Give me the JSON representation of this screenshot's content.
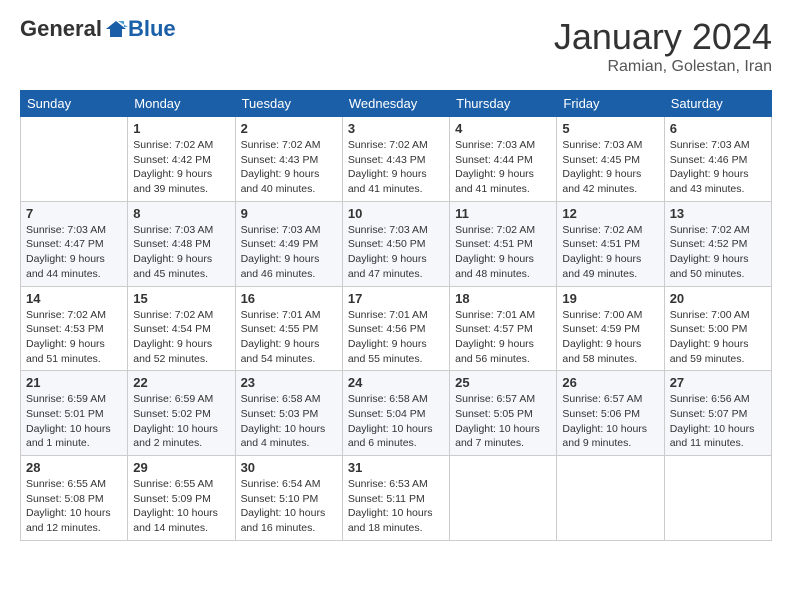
{
  "header": {
    "logo": {
      "general": "General",
      "blue": "Blue"
    },
    "month": "January 2024",
    "location": "Ramian, Golestan, Iran"
  },
  "weekdays": [
    "Sunday",
    "Monday",
    "Tuesday",
    "Wednesday",
    "Thursday",
    "Friday",
    "Saturday"
  ],
  "weeks": [
    [
      {
        "day": "",
        "sunrise": "",
        "sunset": "",
        "daylight": ""
      },
      {
        "day": "1",
        "sunrise": "Sunrise: 7:02 AM",
        "sunset": "Sunset: 4:42 PM",
        "daylight": "Daylight: 9 hours and 39 minutes."
      },
      {
        "day": "2",
        "sunrise": "Sunrise: 7:02 AM",
        "sunset": "Sunset: 4:43 PM",
        "daylight": "Daylight: 9 hours and 40 minutes."
      },
      {
        "day": "3",
        "sunrise": "Sunrise: 7:02 AM",
        "sunset": "Sunset: 4:43 PM",
        "daylight": "Daylight: 9 hours and 41 minutes."
      },
      {
        "day": "4",
        "sunrise": "Sunrise: 7:03 AM",
        "sunset": "Sunset: 4:44 PM",
        "daylight": "Daylight: 9 hours and 41 minutes."
      },
      {
        "day": "5",
        "sunrise": "Sunrise: 7:03 AM",
        "sunset": "Sunset: 4:45 PM",
        "daylight": "Daylight: 9 hours and 42 minutes."
      },
      {
        "day": "6",
        "sunrise": "Sunrise: 7:03 AM",
        "sunset": "Sunset: 4:46 PM",
        "daylight": "Daylight: 9 hours and 43 minutes."
      }
    ],
    [
      {
        "day": "7",
        "sunrise": "Sunrise: 7:03 AM",
        "sunset": "Sunset: 4:47 PM",
        "daylight": "Daylight: 9 hours and 44 minutes."
      },
      {
        "day": "8",
        "sunrise": "Sunrise: 7:03 AM",
        "sunset": "Sunset: 4:48 PM",
        "daylight": "Daylight: 9 hours and 45 minutes."
      },
      {
        "day": "9",
        "sunrise": "Sunrise: 7:03 AM",
        "sunset": "Sunset: 4:49 PM",
        "daylight": "Daylight: 9 hours and 46 minutes."
      },
      {
        "day": "10",
        "sunrise": "Sunrise: 7:03 AM",
        "sunset": "Sunset: 4:50 PM",
        "daylight": "Daylight: 9 hours and 47 minutes."
      },
      {
        "day": "11",
        "sunrise": "Sunrise: 7:02 AM",
        "sunset": "Sunset: 4:51 PM",
        "daylight": "Daylight: 9 hours and 48 minutes."
      },
      {
        "day": "12",
        "sunrise": "Sunrise: 7:02 AM",
        "sunset": "Sunset: 4:51 PM",
        "daylight": "Daylight: 9 hours and 49 minutes."
      },
      {
        "day": "13",
        "sunrise": "Sunrise: 7:02 AM",
        "sunset": "Sunset: 4:52 PM",
        "daylight": "Daylight: 9 hours and 50 minutes."
      }
    ],
    [
      {
        "day": "14",
        "sunrise": "Sunrise: 7:02 AM",
        "sunset": "Sunset: 4:53 PM",
        "daylight": "Daylight: 9 hours and 51 minutes."
      },
      {
        "day": "15",
        "sunrise": "Sunrise: 7:02 AM",
        "sunset": "Sunset: 4:54 PM",
        "daylight": "Daylight: 9 hours and 52 minutes."
      },
      {
        "day": "16",
        "sunrise": "Sunrise: 7:01 AM",
        "sunset": "Sunset: 4:55 PM",
        "daylight": "Daylight: 9 hours and 54 minutes."
      },
      {
        "day": "17",
        "sunrise": "Sunrise: 7:01 AM",
        "sunset": "Sunset: 4:56 PM",
        "daylight": "Daylight: 9 hours and 55 minutes."
      },
      {
        "day": "18",
        "sunrise": "Sunrise: 7:01 AM",
        "sunset": "Sunset: 4:57 PM",
        "daylight": "Daylight: 9 hours and 56 minutes."
      },
      {
        "day": "19",
        "sunrise": "Sunrise: 7:00 AM",
        "sunset": "Sunset: 4:59 PM",
        "daylight": "Daylight: 9 hours and 58 minutes."
      },
      {
        "day": "20",
        "sunrise": "Sunrise: 7:00 AM",
        "sunset": "Sunset: 5:00 PM",
        "daylight": "Daylight: 9 hours and 59 minutes."
      }
    ],
    [
      {
        "day": "21",
        "sunrise": "Sunrise: 6:59 AM",
        "sunset": "Sunset: 5:01 PM",
        "daylight": "Daylight: 10 hours and 1 minute."
      },
      {
        "day": "22",
        "sunrise": "Sunrise: 6:59 AM",
        "sunset": "Sunset: 5:02 PM",
        "daylight": "Daylight: 10 hours and 2 minutes."
      },
      {
        "day": "23",
        "sunrise": "Sunrise: 6:58 AM",
        "sunset": "Sunset: 5:03 PM",
        "daylight": "Daylight: 10 hours and 4 minutes."
      },
      {
        "day": "24",
        "sunrise": "Sunrise: 6:58 AM",
        "sunset": "Sunset: 5:04 PM",
        "daylight": "Daylight: 10 hours and 6 minutes."
      },
      {
        "day": "25",
        "sunrise": "Sunrise: 6:57 AM",
        "sunset": "Sunset: 5:05 PM",
        "daylight": "Daylight: 10 hours and 7 minutes."
      },
      {
        "day": "26",
        "sunrise": "Sunrise: 6:57 AM",
        "sunset": "Sunset: 5:06 PM",
        "daylight": "Daylight: 10 hours and 9 minutes."
      },
      {
        "day": "27",
        "sunrise": "Sunrise: 6:56 AM",
        "sunset": "Sunset: 5:07 PM",
        "daylight": "Daylight: 10 hours and 11 minutes."
      }
    ],
    [
      {
        "day": "28",
        "sunrise": "Sunrise: 6:55 AM",
        "sunset": "Sunset: 5:08 PM",
        "daylight": "Daylight: 10 hours and 12 minutes."
      },
      {
        "day": "29",
        "sunrise": "Sunrise: 6:55 AM",
        "sunset": "Sunset: 5:09 PM",
        "daylight": "Daylight: 10 hours and 14 minutes."
      },
      {
        "day": "30",
        "sunrise": "Sunrise: 6:54 AM",
        "sunset": "Sunset: 5:10 PM",
        "daylight": "Daylight: 10 hours and 16 minutes."
      },
      {
        "day": "31",
        "sunrise": "Sunrise: 6:53 AM",
        "sunset": "Sunset: 5:11 PM",
        "daylight": "Daylight: 10 hours and 18 minutes."
      },
      {
        "day": "",
        "sunrise": "",
        "sunset": "",
        "daylight": ""
      },
      {
        "day": "",
        "sunrise": "",
        "sunset": "",
        "daylight": ""
      },
      {
        "day": "",
        "sunrise": "",
        "sunset": "",
        "daylight": ""
      }
    ]
  ]
}
